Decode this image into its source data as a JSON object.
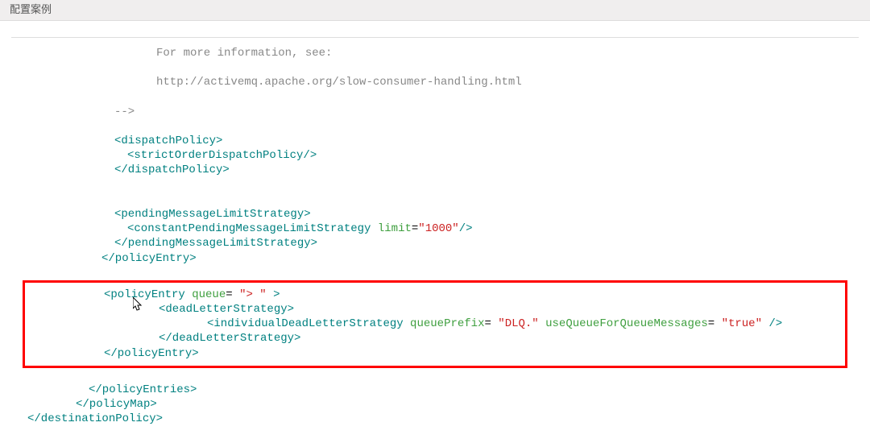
{
  "header": {
    "title": "配置案例"
  },
  "code": {
    "line1": "For more information, see:",
    "line2": "http://activemq.apache.org/slow-consumer-handling.html",
    "line3_close": "-->",
    "dispatchPolicy_open": "<dispatchPolicy>",
    "strictOrderDispatchPolicy": "<strictOrderDispatchPolicy/>",
    "dispatchPolicy_close": "</dispatchPolicy>",
    "pendingMessageLimitStrategy_open": "<pendingMessageLimitStrategy>",
    "constantPending_lt": "<",
    "constantPending_name": "constantPendingMessageLimitStrategy",
    "constantPending_attr": " limit",
    "constantPending_eq": "=",
    "constantPending_val": "\"1000\"",
    "constantPending_end": "/>",
    "pendingMessageLimitStrategy_close": "</pendingMessageLimitStrategy>",
    "policyEntry_close1": "</policyEntry>",
    "policyEntry_open_lt": "<",
    "policyEntry_open_name": "policyEntry",
    "policyEntry_open_attr": " queue",
    "policyEntry_open_eq": "= ",
    "policyEntry_open_val": "\"> \"",
    "policyEntry_open_end": " >",
    "deadLetterStrategy_open": "<deadLetterStrategy>",
    "individualDead_lt": "<",
    "individualDead_name": "individualDeadLetterStrategy",
    "individualDead_attr1": " queuePrefix",
    "individualDead_eq1": "= ",
    "individualDead_val1": "\"DLQ.\"",
    "individualDead_attr2": " useQueueForQueueMessages",
    "individualDead_eq2": "= ",
    "individualDead_val2": "\"true\"",
    "individualDead_end": " />",
    "deadLetterStrategy_close": "</deadLetterStrategy>",
    "policyEntry_close2": "</policyEntry>",
    "policyEntries_close": "</policyEntries>",
    "policyMap_close": "</policyMap>",
    "destinationPolicy_close": "</destinationPolicy>"
  }
}
